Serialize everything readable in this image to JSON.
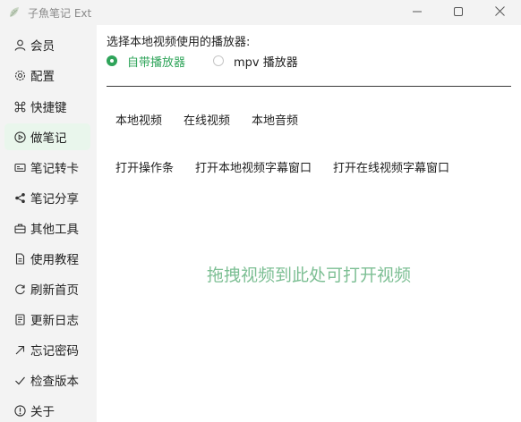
{
  "window": {
    "title": "子魚笔记 Ext"
  },
  "icons": {
    "app": "leaf-logo-icon",
    "minimize": "minimize-icon",
    "maximize": "maximize-icon",
    "close": "close-icon"
  },
  "colors": {
    "accent": "#2fa45a",
    "active_bg": "#e9f6ec",
    "drop_hint": "#7dbf94"
  },
  "sidebar": {
    "active_index": 3,
    "items": [
      {
        "label": "会员",
        "icon": "user-icon"
      },
      {
        "label": "配置",
        "icon": "gear-icon"
      },
      {
        "label": "快捷键",
        "icon": "command-key-icon"
      },
      {
        "label": "做笔记",
        "icon": "play-circle-icon"
      },
      {
        "label": "笔记转卡",
        "icon": "card-icon"
      },
      {
        "label": "笔记分享",
        "icon": "share-icon"
      },
      {
        "label": "其他工具",
        "icon": "toolbox-icon"
      },
      {
        "label": "使用教程",
        "icon": "document-icon"
      },
      {
        "label": "刷新首页",
        "icon": "refresh-icon"
      },
      {
        "label": "更新日志",
        "icon": "log-icon"
      },
      {
        "label": "忘记密码",
        "icon": "arrow-up-right-icon"
      },
      {
        "label": "检查版本",
        "icon": "check-icon"
      },
      {
        "label": "关于",
        "icon": "info-icon"
      }
    ]
  },
  "main": {
    "player_label": "选择本地视频使用的播放器:",
    "players": [
      {
        "label": "自带播放器",
        "checked": true
      },
      {
        "label": "mpv 播放器",
        "checked": false
      }
    ],
    "row1": [
      "本地视频",
      "在线视频",
      "本地音频"
    ],
    "row2": [
      "打开操作条",
      "打开本地视频字幕窗口",
      "打开在线视频字幕窗口"
    ],
    "drop_hint": "拖拽视频到此处可打开视频"
  }
}
